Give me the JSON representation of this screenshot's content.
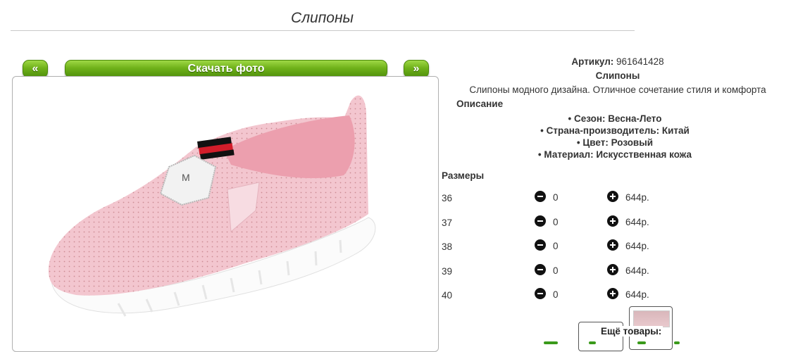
{
  "page": {
    "title": "Слипоны"
  },
  "nav": {
    "prev_label": "«",
    "download_label": "Скачать фото",
    "next_label": "»"
  },
  "product": {
    "article_label": "Артикул:",
    "article_value": "961641428",
    "name": "Слипоны",
    "tagline": "Слипоны модного дизайна. Отличное сочетание стиля и комфорта",
    "description_heading": "Описание",
    "attributes": [
      "Сезон: Весна-Лето",
      "Страна-производитель: Китай",
      "Цвет: Розовый",
      "Материал: Искусственная кожа"
    ]
  },
  "sizes": {
    "heading": "Размеры",
    "rows": [
      {
        "size": "36",
        "qty": "0",
        "price": "644р."
      },
      {
        "size": "37",
        "qty": "0",
        "price": "644р."
      },
      {
        "size": "38",
        "qty": "0",
        "price": "644р."
      },
      {
        "size": "39",
        "qty": "0",
        "price": "644р."
      },
      {
        "size": "40",
        "qty": "0",
        "price": "644р."
      }
    ]
  },
  "more": {
    "label": "Ещё товары:"
  },
  "icons": {
    "minus": "minus-circle-icon",
    "plus": "plus-circle-icon"
  },
  "colors": {
    "button_green": "#6fb11a",
    "shoe_pink": "#f3c6cf"
  }
}
